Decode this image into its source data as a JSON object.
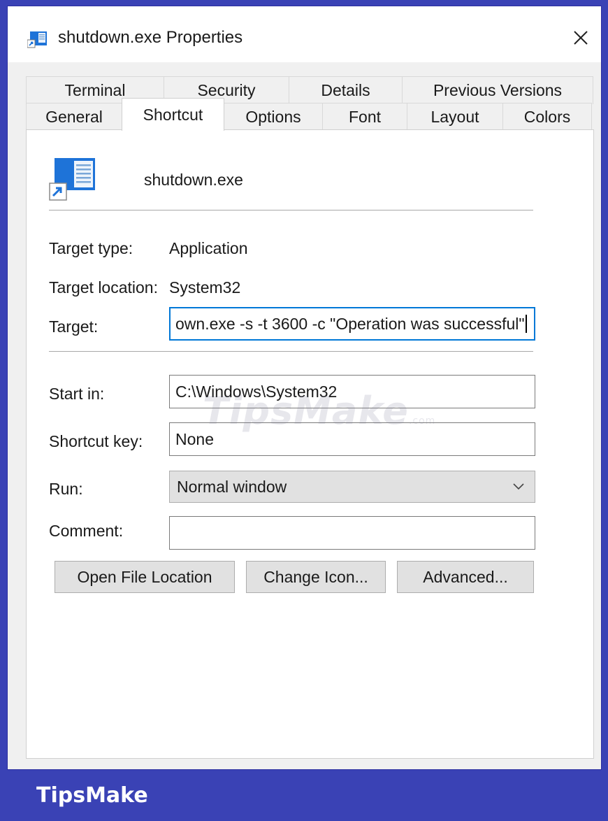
{
  "window": {
    "title": "shutdown.exe Properties",
    "icon": "shortcut-window-icon",
    "close_glyph": "✕"
  },
  "tabs": {
    "row_top": [
      "Terminal",
      "Security",
      "Details",
      "Previous Versions"
    ],
    "row_bottom": [
      "General",
      "Shortcut",
      "Options",
      "Font",
      "Layout",
      "Colors"
    ],
    "active": "Shortcut"
  },
  "shortcut": {
    "app_name": "shutdown.exe",
    "target_type_label": "Target type:",
    "target_type_value": "Application",
    "target_location_label": "Target location:",
    "target_location_value": "System32",
    "target_label": "Target:",
    "target_value": "own.exe -s -t 3600 -c \"Operation was successful\"",
    "start_in_label": "Start in:",
    "start_in_value": "C:\\Windows\\System32",
    "shortcut_key_label": "Shortcut key:",
    "shortcut_key_value": "None",
    "run_label": "Run:",
    "run_value": "Normal window",
    "comment_label": "Comment:",
    "comment_value": ""
  },
  "buttons": {
    "open_file_location": "Open File Location",
    "change_icon": "Change Icon...",
    "advanced": "Advanced..."
  },
  "watermark": {
    "text": "TipsMake",
    "suffix": ".com"
  },
  "footer": {
    "brand": "TipsMake"
  },
  "colors": {
    "frame": "#3a42b5",
    "focus_border": "#0078d7",
    "button_face": "#e1e1e1"
  }
}
